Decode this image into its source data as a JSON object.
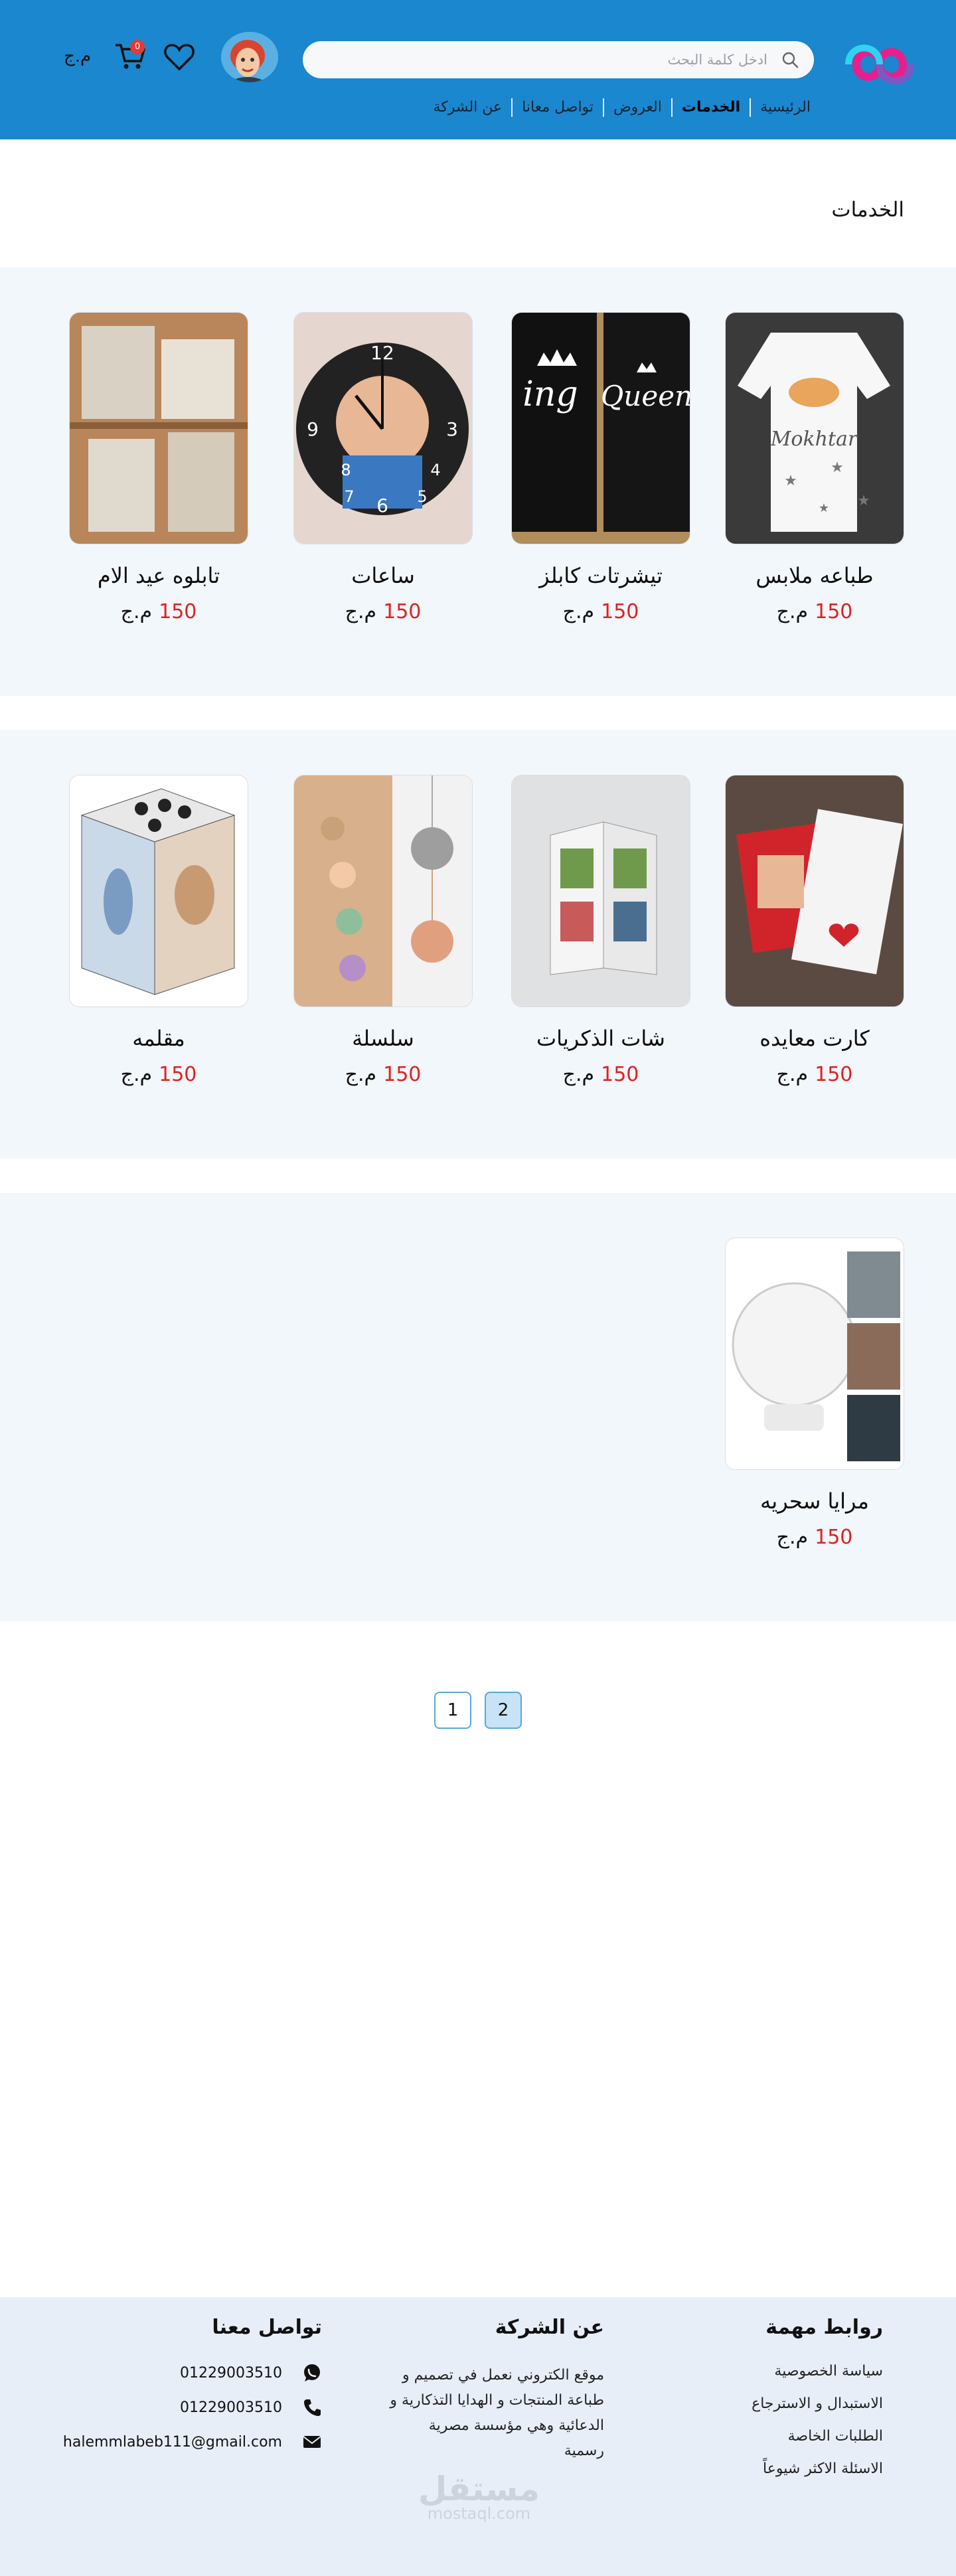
{
  "header": {
    "search_placeholder": "ادخل كلمة البحث",
    "cart_count": "0",
    "currency": "م.ج",
    "nav": [
      "الرئيسية",
      "الخدمات",
      "العروض",
      "تواصل معانا",
      "عن الشركة"
    ],
    "active_nav": "الخدمات",
    "brand_color": "#1a87cf"
  },
  "page": {
    "title": "الخدمات"
  },
  "products": [
    {
      "name": "طباعه ملابس",
      "price": "150",
      "currency": "م.ج",
      "image": "baby-onesie"
    },
    {
      "name": "تيشرتات كابلز",
      "price": "150",
      "currency": "م.ج",
      "image": "couple-tshirts"
    },
    {
      "name": "ساعات",
      "price": "150",
      "currency": "م.ج",
      "image": "photo-clock"
    },
    {
      "name": "تابلوه عيد الام",
      "price": "150",
      "currency": "م.ج",
      "image": "wooden-frame"
    },
    {
      "name": "كارت معايده",
      "price": "150",
      "currency": "م.ج",
      "image": "greeting-card"
    },
    {
      "name": "شات الذكريات",
      "price": "150",
      "currency": "م.ج",
      "image": "memory-book"
    },
    {
      "name": "سلسلة",
      "price": "150",
      "currency": "م.ج",
      "image": "locket-necklace"
    },
    {
      "name": "مقلمه",
      "price": "150",
      "currency": "م.ج",
      "image": "photo-cube"
    },
    {
      "name": "مرايا سحريه",
      "price": "150",
      "currency": "م.ج",
      "image": "magic-mirror"
    }
  ],
  "pagination": {
    "pages": [
      "1",
      "2"
    ],
    "active": "2"
  },
  "footer": {
    "links_title": "روابط مهمة",
    "links": [
      "سياسة الخصوصية",
      "الاستبدال و الاسترجاع",
      "الطلبات الخاصة",
      "الاسئلة الاكثر شيوعاً"
    ],
    "about_title": "عن الشركة",
    "about_text": "موقع الكتروني  نعمل في تصميم و طباعة المنتجات و الهدايا التذكارية و الدعائية وهي مؤسسة مصرية رسمية",
    "contact_title": "تواصل معنا",
    "whatsapp": "01229003510",
    "phone": "01229003510",
    "email": "halemmlabeb111@gmail.com",
    "watermark_ar": "مستقل",
    "watermark_en": "mostaql.com"
  }
}
